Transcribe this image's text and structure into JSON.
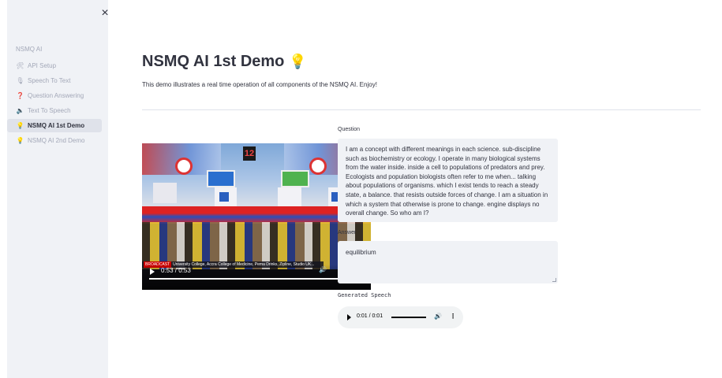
{
  "sidebar": {
    "close_glyph": "×",
    "title": "NSMQ AI",
    "items": [
      {
        "label": "API Setup",
        "icon": "tools-icon",
        "glyph": "🛠",
        "active": false
      },
      {
        "label": "Speech To Text",
        "icon": "microphone-icon",
        "glyph": "🎙",
        "active": false
      },
      {
        "label": "Question Answering",
        "icon": "question-icon",
        "glyph": "❓",
        "active": false
      },
      {
        "label": "Text To Speech",
        "icon": "speaker-icon",
        "glyph": "🔈",
        "active": false
      },
      {
        "label": "NSMQ AI 1st Demo",
        "icon": "lightbulb-icon",
        "glyph": "💡",
        "active": true
      },
      {
        "label": "NSMQ AI 2nd Demo",
        "icon": "lightbulb-icon",
        "glyph": "💡",
        "active": false
      }
    ]
  },
  "main": {
    "title": "NSMQ AI 1st Demo",
    "title_icon": "💡",
    "description": "This demo illustrates a real time operation of all components of the NSMQ AI. Enjoy!"
  },
  "video": {
    "time": "0:53 / 0:53",
    "score_display": "12",
    "ticker_tag": "BROADCAST",
    "ticker_text": "University College, Accra College of Medicine, Pema Drinks, Zipline, Studio UK...",
    "progress": 1.0
  },
  "question": {
    "label": "Question",
    "text": "I am a concept with different meanings in each science. sub-discipline such as biochemistry or ecology. I operate in many biological systems from the water inside. inside a cell to populations of predators and prey. Ecologists and population biologists often refer to me when... talking about populations of organisms. which I exist tends to reach a steady state, a balance. that resists outside forces of change. I am a situation in which a system that otherwise is prone to change. engine displays no overall change. So who am I?"
  },
  "answer": {
    "label": "Answer",
    "value": "equilibrium"
  },
  "speech": {
    "label": "Generated Speech",
    "time": "0:01 / 0:01",
    "progress": 1.0
  },
  "colors": {
    "sidebar_bg": "#f0f2f6",
    "text": "#31333f",
    "muted": "#a3a8b8",
    "field_bg": "#f0f2f6",
    "bulb": "#f4b400"
  }
}
